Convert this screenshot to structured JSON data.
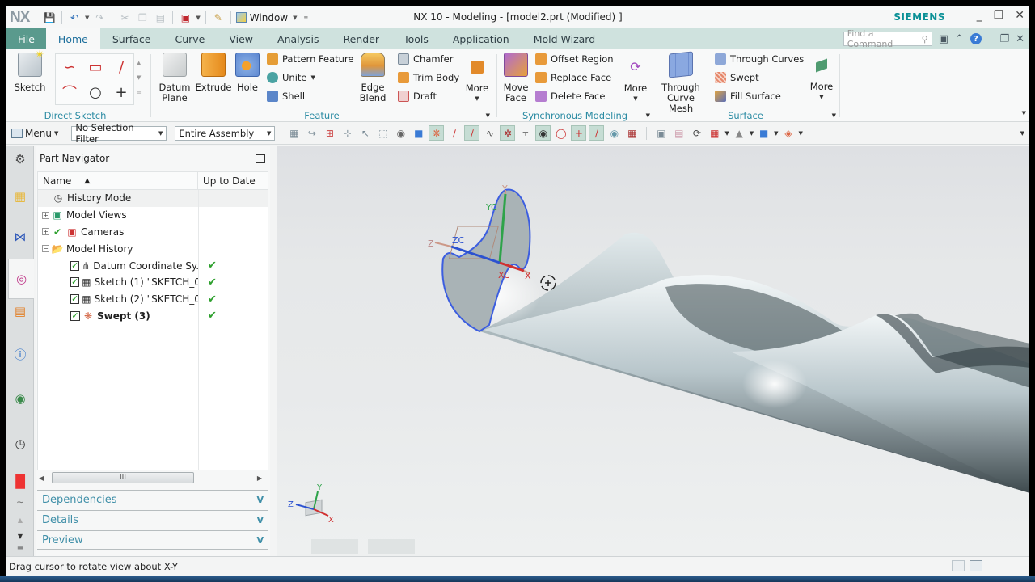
{
  "app": {
    "logo": "NX",
    "window_title": "NX 10 - Modeling - [model2.prt (Modified) ]",
    "brand": "SIEMENS",
    "window_menu_label": "Window"
  },
  "menu_tabs": [
    {
      "label": "File"
    },
    {
      "label": "Home",
      "active": true
    },
    {
      "label": "Surface"
    },
    {
      "label": "Curve"
    },
    {
      "label": "View"
    },
    {
      "label": "Analysis"
    },
    {
      "label": "Render"
    },
    {
      "label": "Tools"
    },
    {
      "label": "Application"
    },
    {
      "label": "Mold Wizard"
    }
  ],
  "find_command": {
    "placeholder": "Find a Command"
  },
  "ribbon": {
    "direct_sketch": {
      "label": "Direct Sketch",
      "sketch_button": "Sketch"
    },
    "feature": {
      "label": "Feature",
      "datum_plane": "Datum Plane",
      "extrude": "Extrude",
      "hole": "Hole",
      "pattern_feature": "Pattern Feature",
      "unite": "Unite",
      "shell": "Shell",
      "edge_blend": "Edge Blend",
      "chamfer": "Chamfer",
      "trim_body": "Trim Body",
      "draft": "Draft",
      "more": "More"
    },
    "synchronous": {
      "label": "Synchronous Modeling",
      "move_face": "Move Face",
      "offset_region": "Offset Region",
      "replace_face": "Replace Face",
      "delete_face": "Delete Face",
      "more": "More"
    },
    "surface": {
      "label": "Surface",
      "through_curve_mesh": "Through Curve Mesh",
      "through_curves": "Through Curves",
      "swept": "Swept",
      "fill_surface": "Fill Surface",
      "more": "More"
    }
  },
  "toolbar2": {
    "menu_label": "Menu",
    "selection_filter": "No Selection Filter",
    "assembly_scope": "Entire Assembly"
  },
  "navigator": {
    "title": "Part Navigator",
    "col_name": "Name",
    "col_status": "Up to Date",
    "rows": [
      {
        "label": "History Mode",
        "status": ""
      },
      {
        "label": "Model Views",
        "status": ""
      },
      {
        "label": "Cameras",
        "status": ""
      },
      {
        "label": "Model History",
        "status": ""
      },
      {
        "label": "Datum Coordinate Sy...",
        "status": "✔"
      },
      {
        "label": "Sketch (1) \"SKETCH_0...",
        "status": "✔"
      },
      {
        "label": "Sketch (2) \"SKETCH_0...",
        "status": "✔"
      },
      {
        "label": "Swept (3)",
        "status": "✔"
      }
    ],
    "scroll_grip": "III",
    "panels": [
      {
        "label": "Dependencies"
      },
      {
        "label": "Details"
      },
      {
        "label": "Preview"
      }
    ]
  },
  "viewport": {
    "csys_labels": {
      "x": "X",
      "y": "Y",
      "z": "Z",
      "xc": "XC",
      "yc": "YC",
      "zc": "ZC"
    },
    "triad_labels": {
      "x": "X",
      "y": "Y",
      "z": "Z"
    }
  },
  "status": {
    "message": "Drag cursor to rotate view about X-Y"
  }
}
